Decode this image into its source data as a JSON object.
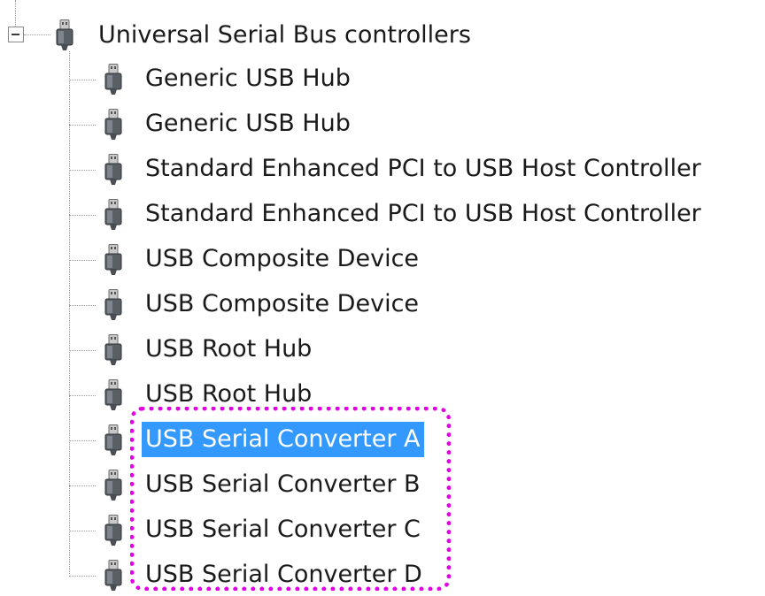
{
  "tree": {
    "root": {
      "label": "Universal Serial Bus controllers",
      "icon": "usb-plug-icon",
      "expander": "collapse-minus"
    },
    "children": [
      {
        "label": "Generic USB Hub",
        "icon": "usb-plug-icon",
        "selected": false
      },
      {
        "label": "Generic USB Hub",
        "icon": "usb-plug-icon",
        "selected": false
      },
      {
        "label": "Standard Enhanced PCI to USB Host Controller",
        "icon": "usb-plug-icon",
        "selected": false
      },
      {
        "label": "Standard Enhanced PCI to USB Host Controller",
        "icon": "usb-plug-icon",
        "selected": false
      },
      {
        "label": "USB Composite Device",
        "icon": "usb-plug-icon",
        "selected": false
      },
      {
        "label": "USB Composite Device",
        "icon": "usb-plug-icon",
        "selected": false
      },
      {
        "label": "USB Root Hub",
        "icon": "usb-plug-icon",
        "selected": false
      },
      {
        "label": "USB Root Hub",
        "icon": "usb-plug-icon",
        "selected": false
      },
      {
        "label": "USB Serial Converter A",
        "icon": "usb-plug-icon",
        "selected": true
      },
      {
        "label": "USB Serial Converter B",
        "icon": "usb-plug-icon",
        "selected": false
      },
      {
        "label": "USB Serial Converter C",
        "icon": "usb-plug-icon",
        "selected": false
      },
      {
        "label": "USB Serial Converter D",
        "icon": "usb-plug-icon",
        "selected": false
      }
    ]
  },
  "colors": {
    "selection_bg": "#3399ff",
    "selection_text": "#ffffff",
    "highlight_outline": "#e400e4",
    "tree_lines": "#9a9a9a",
    "text": "#1a1a1a"
  }
}
